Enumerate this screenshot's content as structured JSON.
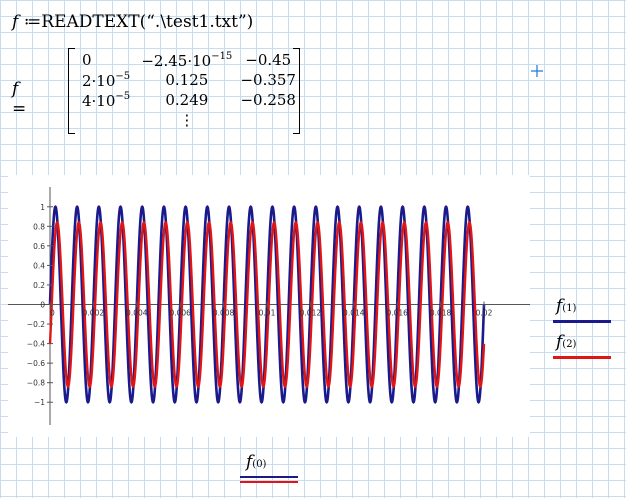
{
  "definition": {
    "variable": "f",
    "operator": "≔",
    "function_name": "READTEXT",
    "argument": "“.\\test1.txt”"
  },
  "result": {
    "variable": "f",
    "operator": "=",
    "matrix": [
      [
        "0",
        "−2.45·10^−15",
        "−0.45"
      ],
      [
        "2·10^−5",
        "0.125",
        "−0.357"
      ],
      [
        "4·10^−5",
        "0.249",
        "−0.258"
      ],
      [
        "",
        "⋮",
        ""
      ]
    ]
  },
  "cursor_icon": "crosshair-plus-icon",
  "chart_data": {
    "type": "line",
    "xlim": [
      0,
      0.02
    ],
    "ylim": [
      -1.1,
      1.1
    ],
    "x_ticks": [
      "0",
      "0.002",
      "0.004",
      "0.006",
      "0.008",
      "0.01",
      "0.012",
      "0.014",
      "0.016",
      "0.018",
      "0.02"
    ],
    "y_ticks": [
      "1",
      "0.8",
      "0.6",
      "0.4",
      "0.2",
      "0",
      "−0.2",
      "−0.4",
      "−0.6",
      "−0.8",
      "−1"
    ],
    "x_axis_label": "f(0)",
    "grid": false,
    "legend_placement": "right",
    "series": [
      {
        "name": "f(1)",
        "color": "#1a1a8c",
        "amplitude": 1.0,
        "frequency": 1000,
        "phase": 0,
        "x_end": 0.02
      },
      {
        "name": "f(2)",
        "color": "#e01515",
        "amplitude": 0.84,
        "frequency": 1000,
        "phase": -0.5,
        "x_end": 0.02
      }
    ]
  },
  "legend": {
    "series1": {
      "base": "f",
      "sup": "(1)",
      "color": "#1a1a8c"
    },
    "series2": {
      "base": "f",
      "sup": "(2)",
      "color": "#e01515"
    },
    "xaxis": {
      "base": "f",
      "sup": "(0)"
    }
  },
  "colors": {
    "grid_line": "#c9dcef",
    "series1": "#1a1a8c",
    "series2": "#e01515"
  }
}
